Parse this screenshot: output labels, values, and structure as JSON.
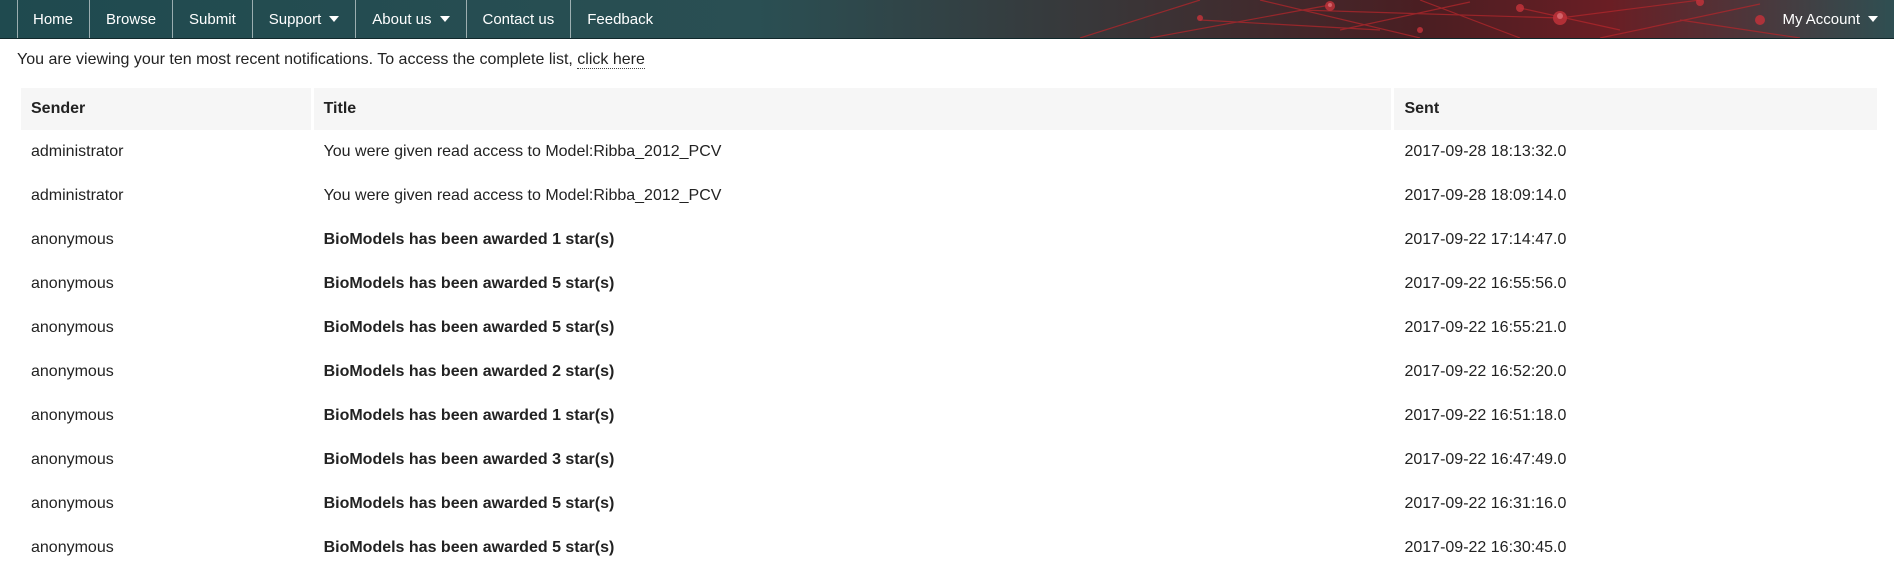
{
  "nav": {
    "items": [
      {
        "label": "Home",
        "has_dropdown": false
      },
      {
        "label": "Browse",
        "has_dropdown": false
      },
      {
        "label": "Submit",
        "has_dropdown": false
      },
      {
        "label": "Support",
        "has_dropdown": true
      },
      {
        "label": "About us",
        "has_dropdown": true
      },
      {
        "label": "Contact us",
        "has_dropdown": false
      },
      {
        "label": "Feedback",
        "has_dropdown": false
      }
    ],
    "account_label": "My Account"
  },
  "intro": {
    "text": "You are viewing your ten most recent notifications. To access the complete list, ",
    "link_label": "click here"
  },
  "table": {
    "headers": {
      "sender": "Sender",
      "title": "Title",
      "sent": "Sent"
    },
    "rows": [
      {
        "sender": "administrator",
        "title": "You were given read access to Model:Ribba_2012_PCV",
        "sent": "2017-09-28 18:13:32.0",
        "bold": false
      },
      {
        "sender": "administrator",
        "title": "You were given read access to Model:Ribba_2012_PCV",
        "sent": "2017-09-28 18:09:14.0",
        "bold": false
      },
      {
        "sender": "anonymous",
        "title": "BioModels has been awarded 1 star(s)",
        "sent": "2017-09-22 17:14:47.0",
        "bold": true
      },
      {
        "sender": "anonymous",
        "title": "BioModels has been awarded 5 star(s)",
        "sent": "2017-09-22 16:55:56.0",
        "bold": true
      },
      {
        "sender": "anonymous",
        "title": "BioModels has been awarded 5 star(s)",
        "sent": "2017-09-22 16:55:21.0",
        "bold": true
      },
      {
        "sender": "anonymous",
        "title": "BioModels has been awarded 2 star(s)",
        "sent": "2017-09-22 16:52:20.0",
        "bold": true
      },
      {
        "sender": "anonymous",
        "title": "BioModels has been awarded 1 star(s)",
        "sent": "2017-09-22 16:51:18.0",
        "bold": true
      },
      {
        "sender": "anonymous",
        "title": "BioModels has been awarded 3 star(s)",
        "sent": "2017-09-22 16:47:49.0",
        "bold": true
      },
      {
        "sender": "anonymous",
        "title": "BioModels has been awarded 5 star(s)",
        "sent": "2017-09-22 16:31:16.0",
        "bold": true
      },
      {
        "sender": "anonymous",
        "title": "BioModels has been awarded 5 star(s)",
        "sent": "2017-09-22 16:30:45.0",
        "bold": true
      }
    ]
  }
}
